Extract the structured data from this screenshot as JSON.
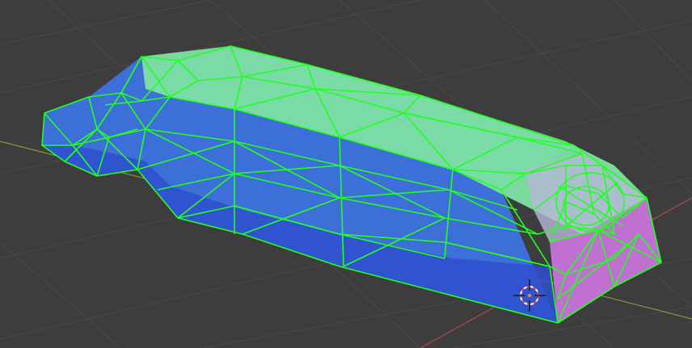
{
  "viewport": {
    "background_color": "#3d3d3d",
    "grid_line_color": "#4a4a4a",
    "x_axis_color": "#b34a4a",
    "y_axis_color": "#7a9a3a"
  },
  "object": {
    "name": "",
    "selected": true,
    "display": "solid-with-wireframe-overlay",
    "wire_color": "#22ff22",
    "face_colors": {
      "top": "#7ee0a3",
      "side": "#3d6fd8",
      "side_dark": "#2e4fcf",
      "rear": "#c070d0"
    }
  },
  "cursor_3d": {
    "icon": "3d-cursor-icon",
    "ring_color_a": "#e64a4a",
    "ring_color_b": "#ffffff"
  }
}
